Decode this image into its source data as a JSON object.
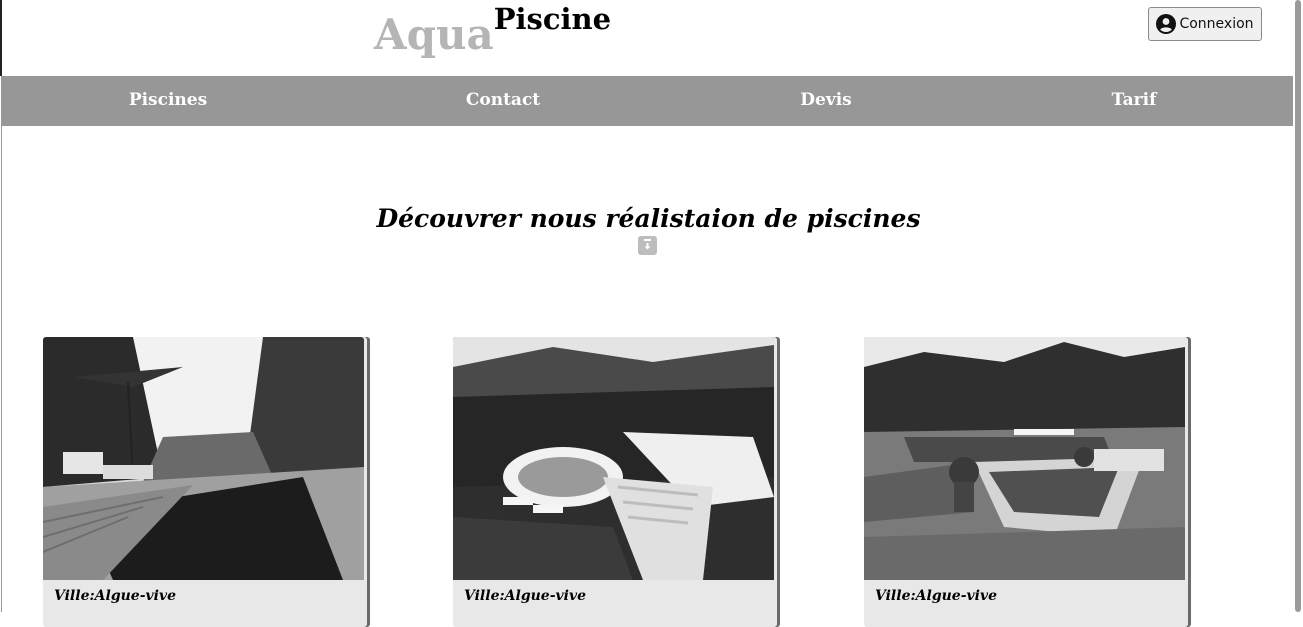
{
  "header": {
    "logo_part1": "Aqua",
    "logo_part2": "Piscine",
    "login_label": "Connexion",
    "login_icon": "user-circle-icon"
  },
  "nav": {
    "items": [
      {
        "label": "Piscines"
      },
      {
        "label": "Contact"
      },
      {
        "label": "Devis"
      },
      {
        "label": "Tarif"
      }
    ]
  },
  "main": {
    "headline": "Découvrer nous réalistaion de piscines",
    "headline_icon": "download-icon"
  },
  "cards": [
    {
      "caption": "Ville:Algue-vive",
      "image": "wooden-deck-pool-photo"
    },
    {
      "caption": "Ville:Algue-vive",
      "image": "curved-villa-pool-photo"
    },
    {
      "caption": "Ville:Algue-vive",
      "image": "infinity-pool-terrace-photo"
    }
  ],
  "colors": {
    "nav_bg": "#979797",
    "logo_light": "#b5b5b5",
    "card_bg": "#e8e8e8"
  }
}
